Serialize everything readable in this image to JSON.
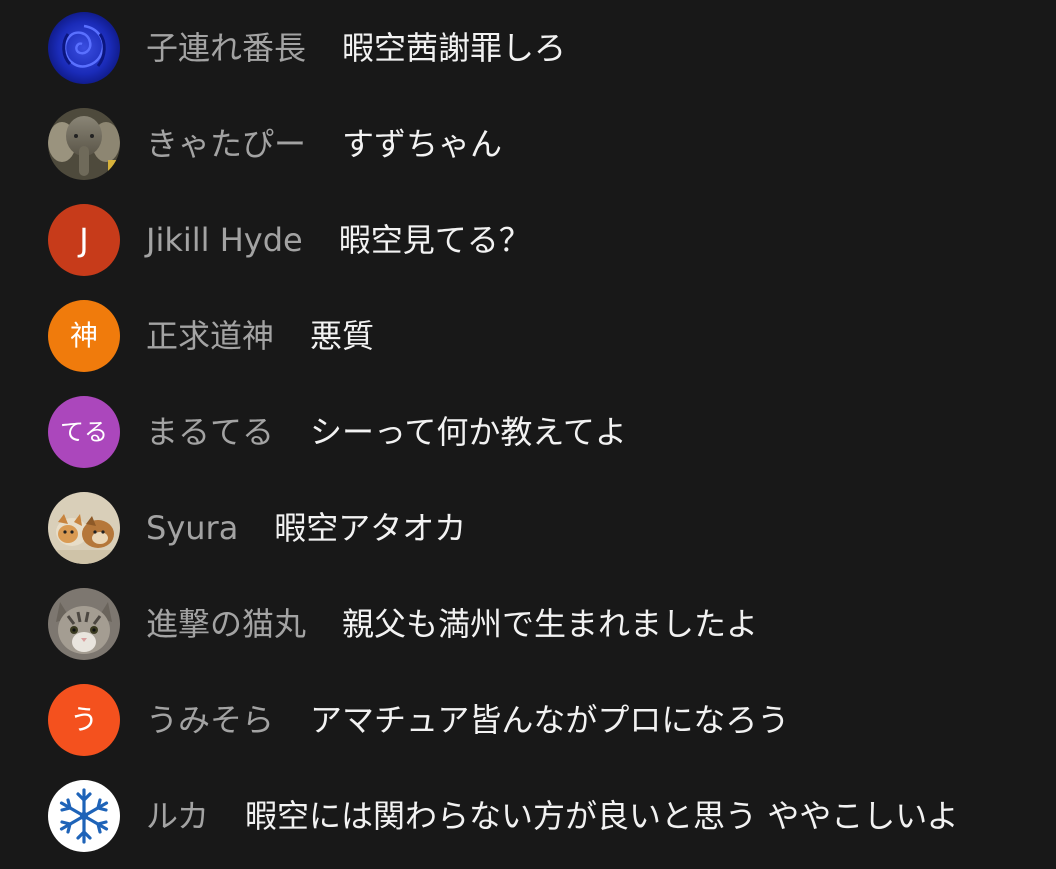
{
  "messages": [
    {
      "author": "子連れ番長",
      "text": "暇空茜謝罪しろ",
      "avatar": {
        "kind": "image",
        "icon": "blue-rose-icon"
      }
    },
    {
      "author": "きゃたぴー",
      "text": "すずちゃん",
      "avatar": {
        "kind": "image",
        "icon": "elephant-icon"
      }
    },
    {
      "author": "Jikill Hyde",
      "text": "暇空見てる？",
      "avatar": {
        "kind": "letter",
        "letter": "J",
        "color": "#c73b1a"
      }
    },
    {
      "author": "正求道神",
      "text": "悪質",
      "avatar": {
        "kind": "letter",
        "letter": "神",
        "color": "#f07b0c"
      }
    },
    {
      "author": "まるてる",
      "text": "シーって何か教えてよ",
      "avatar": {
        "kind": "letter",
        "letter": "てる",
        "color": "#ab47bc"
      }
    },
    {
      "author": "Syura",
      "text": "暇空アタオカ",
      "avatar": {
        "kind": "image",
        "icon": "puppies-icon"
      }
    },
    {
      "author": "進撃の猫丸",
      "text": "親父も満州で生まれましたよ",
      "avatar": {
        "kind": "image",
        "icon": "cat-icon"
      }
    },
    {
      "author": "うみそら",
      "text": "アマチュア皆んながプロになろう",
      "avatar": {
        "kind": "letter",
        "letter": "う",
        "color": "#f4511e"
      }
    },
    {
      "author": "ルカ",
      "text": "暇空には関わらない方が良いと思う ややこしいよ",
      "avatar": {
        "kind": "image",
        "icon": "snowflake-icon"
      }
    }
  ]
}
